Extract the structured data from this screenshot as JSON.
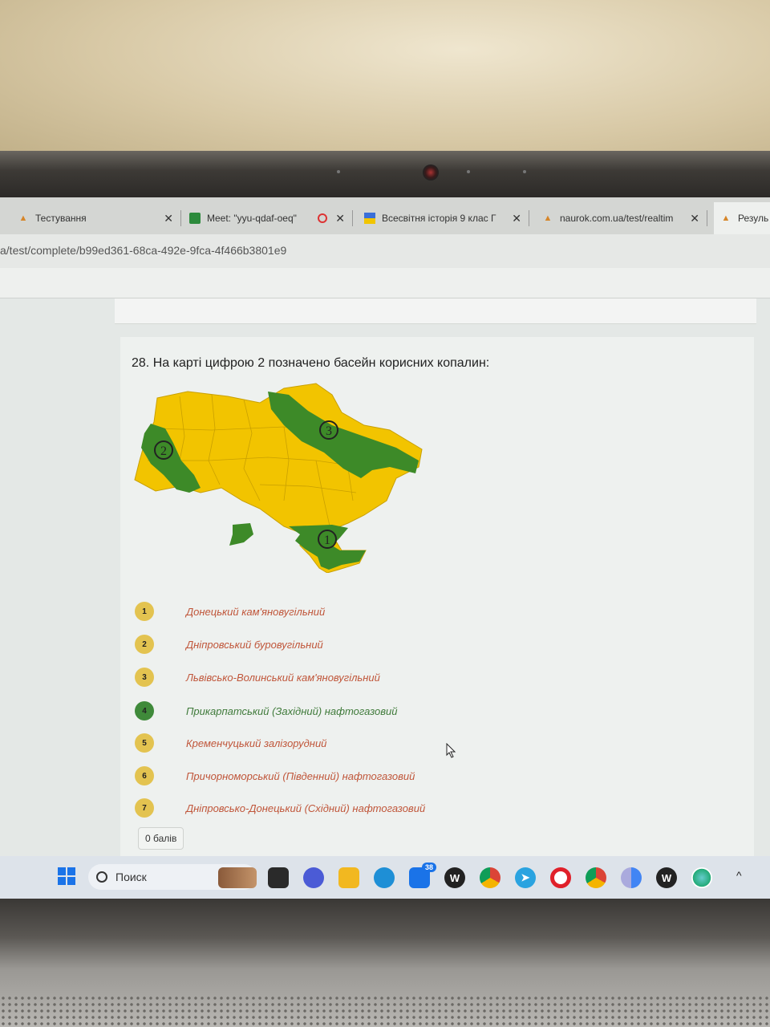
{
  "tabs": [
    {
      "label": "Тестування",
      "icon": "warning-icon"
    },
    {
      "label": "Meet: \"yyu-qdaf-oeq\"",
      "icon": "meet-icon"
    },
    {
      "label": "Всесвітня історія 9 клас Г",
      "icon": "flag-icon"
    },
    {
      "label": "naurok.com.ua/test/realtim",
      "icon": "warning-icon"
    },
    {
      "label": "Резуль",
      "icon": "warning-icon"
    }
  ],
  "address": {
    "url": "a/test/complete/b99ed361-68ca-492e-9fca-4f466b3801e9"
  },
  "question": {
    "text": "28. На карті цифрою 2 позначено басейн корисних копалин:",
    "map_markers": [
      "1",
      "2",
      "3"
    ],
    "map_colors": {
      "yellow": "#f2c400",
      "green": "#3d8a28"
    }
  },
  "options": [
    {
      "num": "1",
      "label": "Донецький кам'яновугільний",
      "badge_color": "#e3c350",
      "text_color": "#c0563a"
    },
    {
      "num": "2",
      "label": " Дніпровський буровугільний",
      "badge_color": "#e3c350",
      "text_color": "#c0563a"
    },
    {
      "num": "3",
      "label": "Львівсько-Волинський кам'яновугільний",
      "badge_color": "#e3c350",
      "text_color": "#c0563a"
    },
    {
      "num": "4",
      "label": "Прикарпатський (Західний) нафтогазовий",
      "badge_color": "#3f8a3a",
      "text_color": "#3f7a3a"
    },
    {
      "num": "5",
      "label": "Кременчуцький залізорудний",
      "badge_color": "#e3c350",
      "text_color": "#c0563a"
    },
    {
      "num": "6",
      "label": "Причорноморський (Південний) нафтогазовий",
      "badge_color": "#e3c350",
      "text_color": "#c0563a"
    },
    {
      "num": "7",
      "label": "Дніпровсько-Донецький (Східний) нафтогазовий",
      "badge_color": "#e3c350",
      "text_color": "#c0563a"
    }
  ],
  "score": "0 балів",
  "taskbar": {
    "search_label": "Поиск",
    "mail_badge": "38",
    "icons": [
      "windows-icon",
      "files-icon",
      "chat-icon",
      "folder-icon",
      "edge-icon",
      "mail-icon",
      "word-icon",
      "chrome-icon",
      "telegram-icon",
      "opera-icon",
      "chrome-icon",
      "chrome-icon",
      "word-icon",
      "globe-icon"
    ]
  }
}
